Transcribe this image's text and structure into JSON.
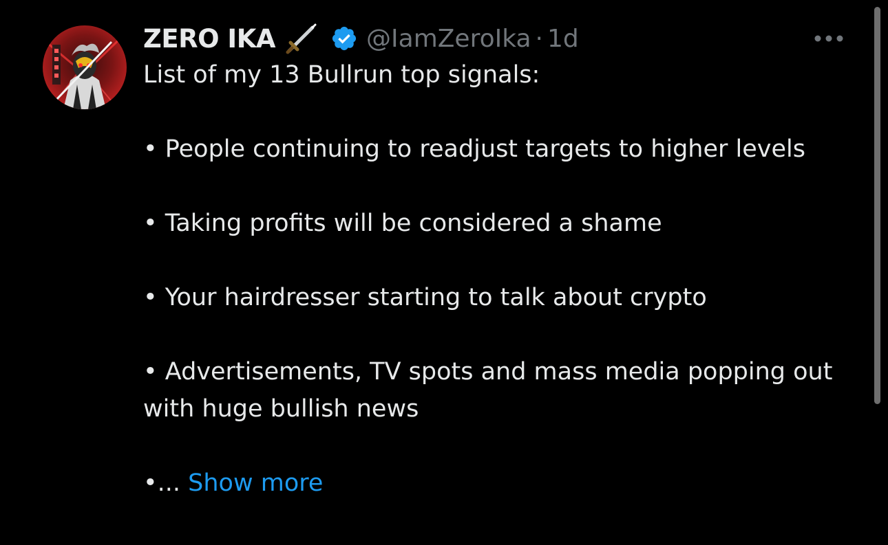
{
  "tweet": {
    "display_name": "ZERO IKA",
    "name_emoji": "dagger-icon",
    "verified_icon": "verified-badge-icon",
    "handle": "@IamZeroIka",
    "separator": "·",
    "timestamp": "1d",
    "more_icon": "more-options-icon",
    "lines": [
      "List of my 13 Bullrun top signals:",
      "",
      "• People continuing to readjust targets to higher levels",
      "",
      "• Taking profits will be considered a shame",
      "",
      "• Your hairdresser starting to talk about crypto",
      "",
      "• Advertisements, TV spots and mass media popping out with huge bullish news",
      ""
    ],
    "truncated_prefix": "•... ",
    "show_more_label": "Show more"
  },
  "colors": {
    "background": "#000000",
    "text_primary": "#e7e9ea",
    "text_secondary": "#71767b",
    "link_blue": "#1d9bf0",
    "verified_blue": "#1d9bf0"
  }
}
